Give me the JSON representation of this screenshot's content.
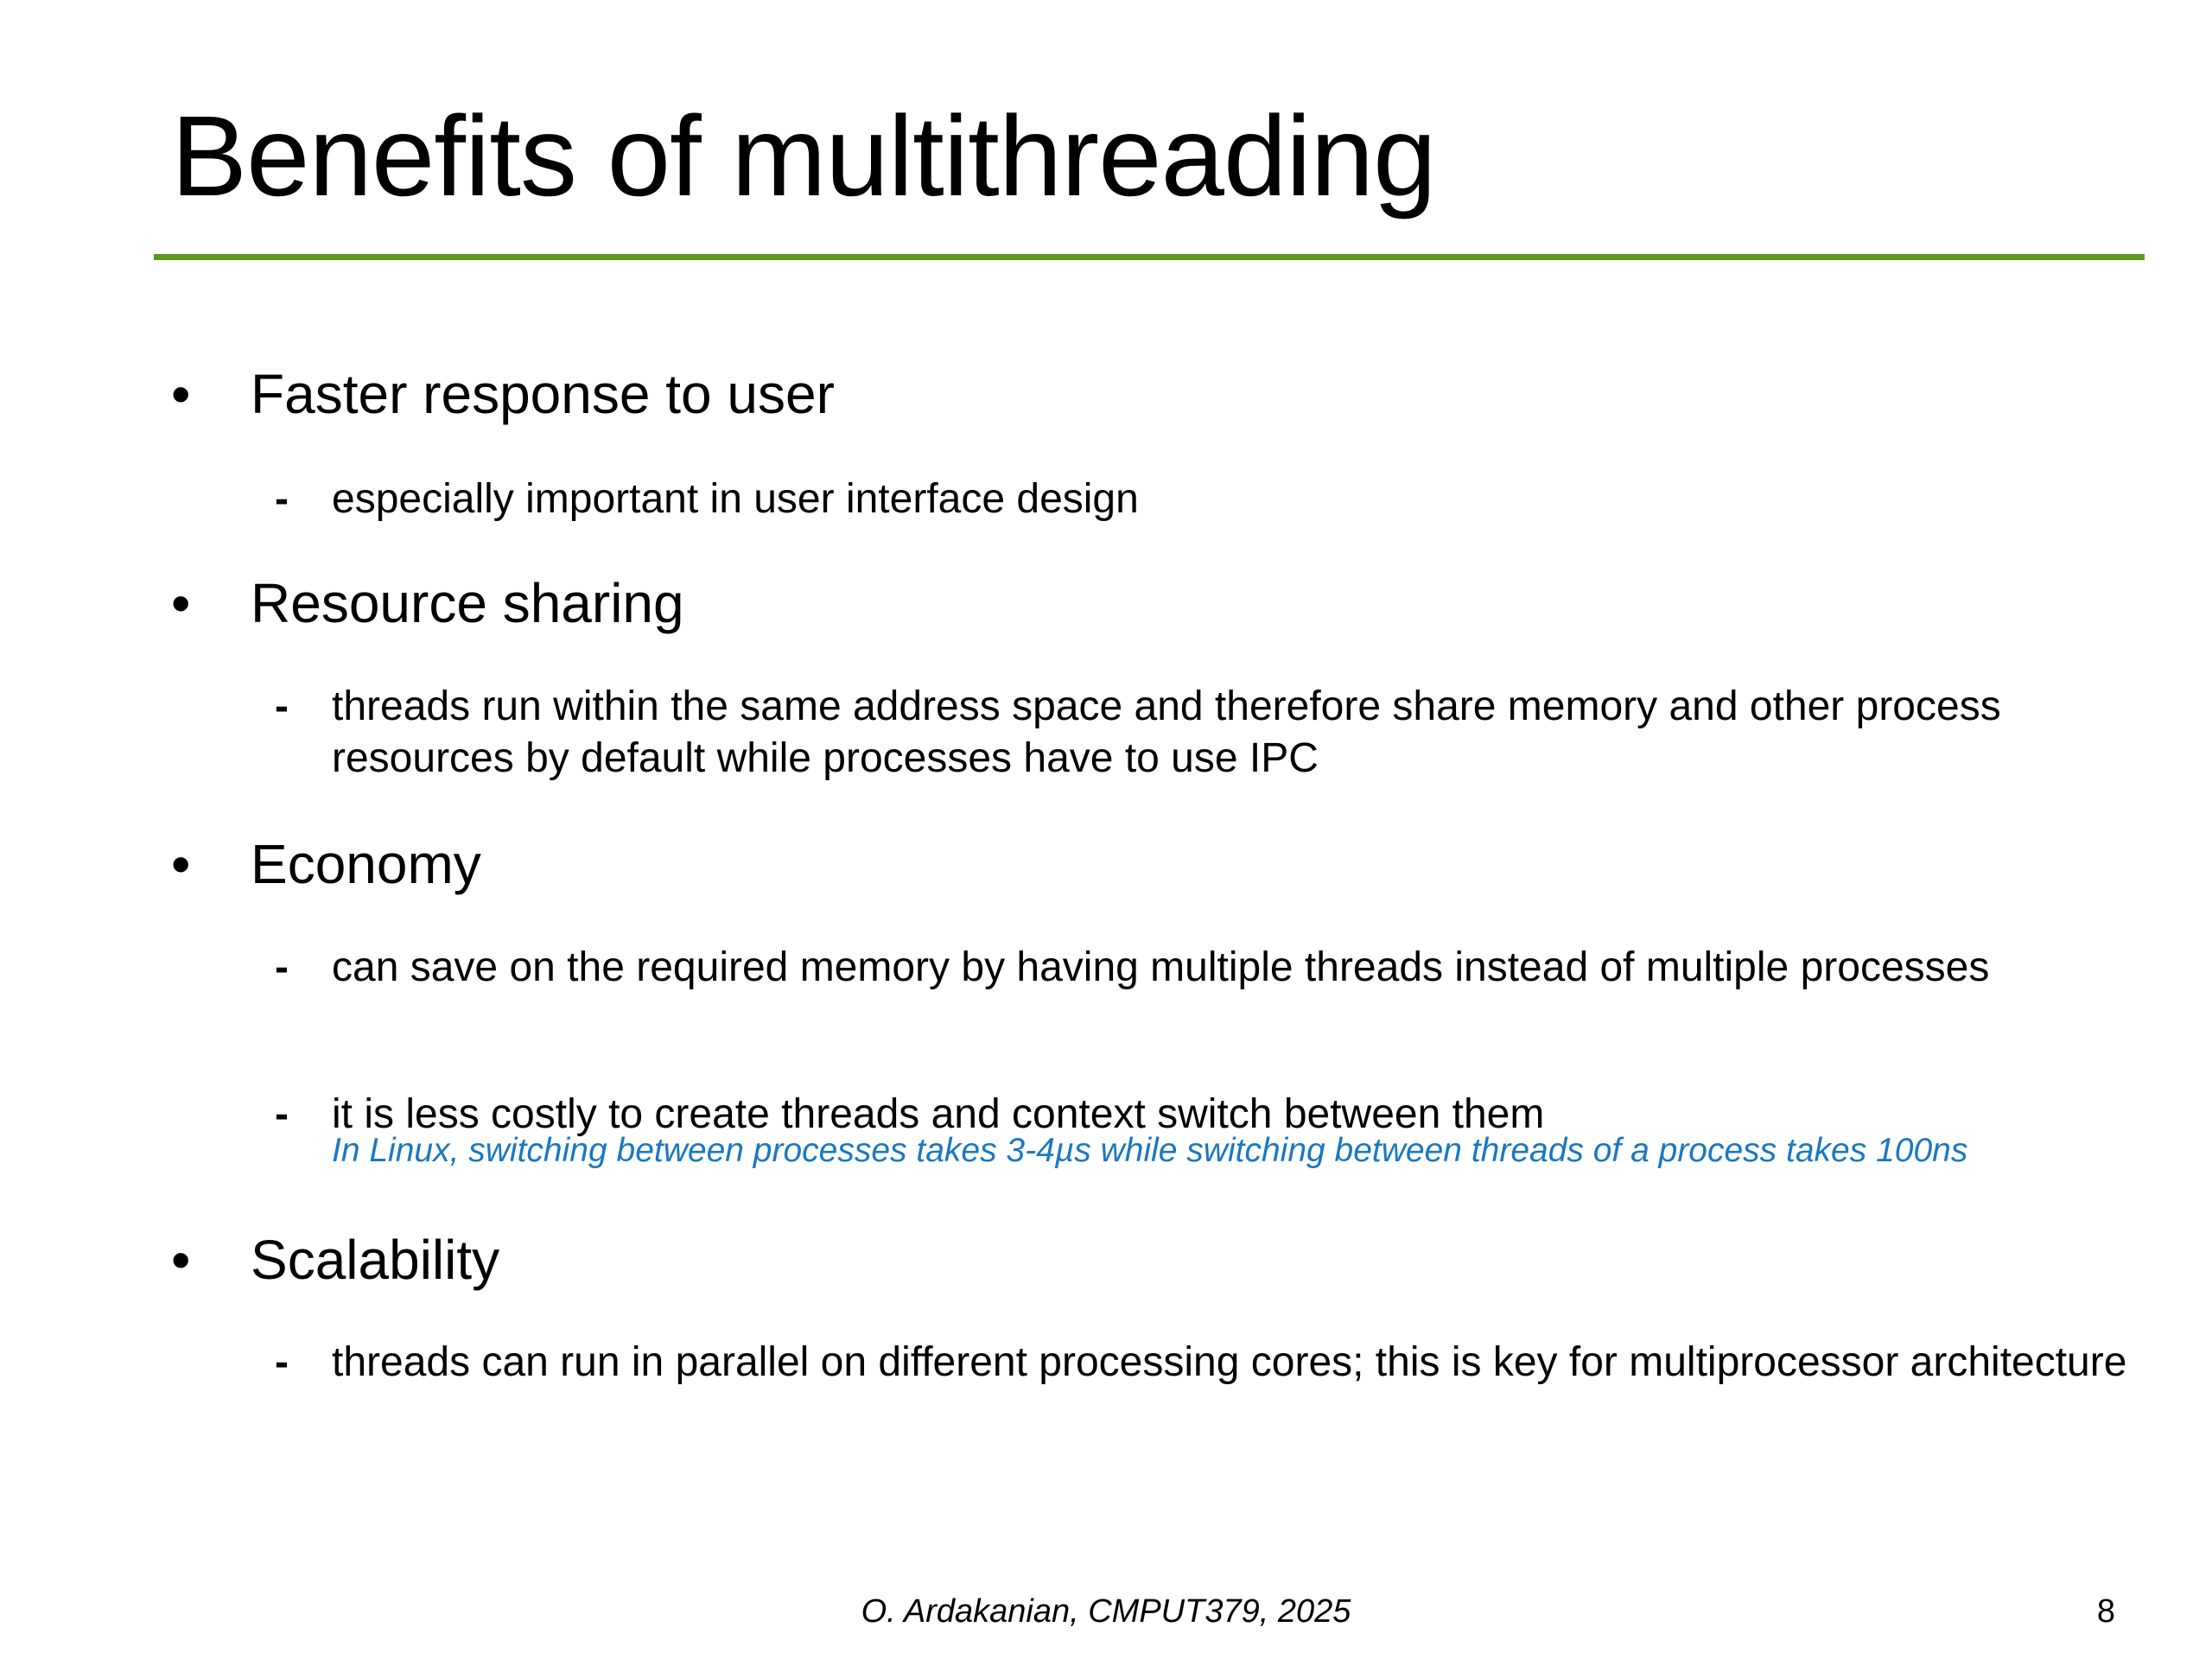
{
  "slide": {
    "title": "Benefits of multithreading",
    "bullets": [
      {
        "label": "Faster response to user",
        "subs": [
          "especially important in user interface design"
        ]
      },
      {
        "label": "Resource sharing",
        "subs": [
          "threads run within the same address space and therefore share memory and other process resources by default while processes have to use IPC"
        ]
      },
      {
        "label": "Economy",
        "subs": [
          "can save on the required memory by having multiple threads instead of multiple processes",
          "it is less costly to create threads and context switch between them"
        ],
        "note": "In Linux, switching between processes takes 3-4µs while switching between threads of a process takes 100ns"
      },
      {
        "label": "Scalability",
        "subs": [
          "threads can run in parallel on different processing cores; this is key for multiprocessor architecture"
        ]
      }
    ],
    "bullet_symbol": "•",
    "dash_symbol": "-",
    "footer": "O. Ardakanian, CMPUT379, 2025",
    "page_number": "8",
    "colors": {
      "rule": "#5a9a1e",
      "note": "#1a78c2"
    }
  }
}
